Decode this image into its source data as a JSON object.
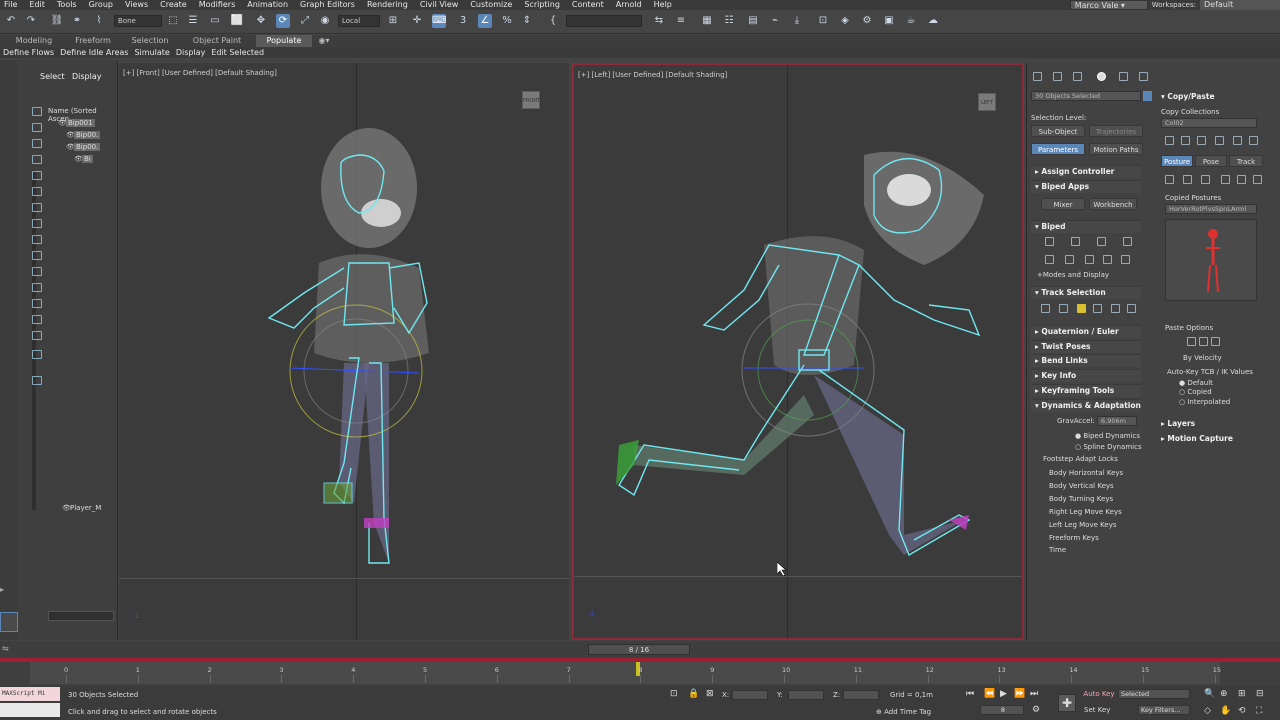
{
  "menu": {
    "items": [
      "File",
      "Edit",
      "Tools",
      "Group",
      "Views",
      "Create",
      "Modifiers",
      "Animation",
      "Graph Editors",
      "Rendering",
      "Civil View",
      "Customize",
      "Scripting",
      "Content",
      "Arnold",
      "Help"
    ],
    "user": "Marco Vale",
    "workspaces_label": "Workspaces:",
    "workspace": "Default"
  },
  "toolbar": {
    "selection_filter": "Bone",
    "ref_coord": "Local"
  },
  "ribbon": {
    "tabs": [
      "Modeling",
      "Freeform",
      "Selection",
      "Object Paint",
      "Populate"
    ],
    "active_tab": "Populate",
    "subtabs": [
      "Define Flows",
      "Define Idle Areas",
      "Simulate",
      "Display",
      "Edit Selected"
    ]
  },
  "scene_explorer": {
    "tabs": [
      "Select",
      "Display"
    ],
    "column": "Name (Sorted Ascen",
    "rows": [
      "Bip001",
      "Bip00.",
      "Bip00.",
      "Bi"
    ],
    "player_row": "Player_M"
  },
  "viewports": {
    "front_label": "[+] [Front] [User Defined] [Default Shading]",
    "left_label": "[+] [Left] [User Defined] [Default Shading]",
    "front_cube": "FRONT",
    "left_cube": "LEFT"
  },
  "command_panel": {
    "objects_selected": "30 Objects Selected",
    "selection_level": "Selection Level:",
    "sub_object": "Sub-Object",
    "trajectories": "Trajectories",
    "parameters": "Parameters",
    "motion_paths": "Motion Paths",
    "rollouts_top": [
      "Assign Controller",
      "Biped Apps"
    ],
    "mixer": "Mixer",
    "workbench": "Workbench",
    "biped": "Biped",
    "modes_display": "+Modes and Display",
    "track_selection": "Track Selection",
    "rollouts_mid": [
      "Quaternion / Euler",
      "Twist Poses",
      "Bend Links",
      "Key Info",
      "Keyframing Tools",
      "Dynamics & Adaptation"
    ],
    "gravaccel_label": "GravAccel:",
    "gravaccel_value": "6,906m",
    "biped_dynamics": "Biped Dynamics",
    "spline_dynamics": "Spline Dynamics",
    "footstep_locks": "Footstep Adapt Locks",
    "locks": [
      "Body Horizontal Keys",
      "Body Vertical Keys",
      "Body Turning Keys",
      "Right Leg Move Keys",
      "Left Leg Move Keys",
      "Freeform Keys",
      "Time"
    ],
    "copy_paste": "Copy/Paste",
    "copy_collections": "Copy Collections",
    "collection_value": "Col02",
    "posture": "Posture",
    "pose": "Pose",
    "track": "Track",
    "copied_postures": "Copied Postures",
    "posture_value": "HorVerRotPlvsSpnLArml",
    "paste_options": "Paste Options",
    "by_velocity": "By Velocity",
    "autokey_tcb": "Auto-Key TCB / IK Values",
    "default": "Default",
    "copied": "Copied",
    "interpolated": "Interpolated",
    "layers": "Layers",
    "motion_capture": "Motion Capture"
  },
  "timeline": {
    "frame_display": "8 / 16",
    "ticks": [
      "0",
      "1",
      "2",
      "3",
      "4",
      "5",
      "6",
      "7",
      "8",
      "9",
      "10",
      "11",
      "12",
      "13",
      "14",
      "15",
      "15"
    ]
  },
  "status": {
    "maxscript": "MAXScript Mi",
    "selected": "30 Objects Selected",
    "hint": "Click and drag to select and rotate objects",
    "x_label": "X:",
    "y_label": "Y:",
    "z_label": "Z:",
    "grid": "Grid = 0,1m",
    "add_time_tag": "Add Time Tag",
    "frame": "8",
    "auto_key": "Auto Key",
    "selected_set": "Selected",
    "set_key": "Set Key",
    "key_filters": "Key Filters..."
  },
  "colors": {
    "accent": "#5b86b8",
    "active_viewport_border": "#8a2a3a",
    "timeline_red": "#9e2035",
    "skeleton": "#6fe8f0"
  }
}
